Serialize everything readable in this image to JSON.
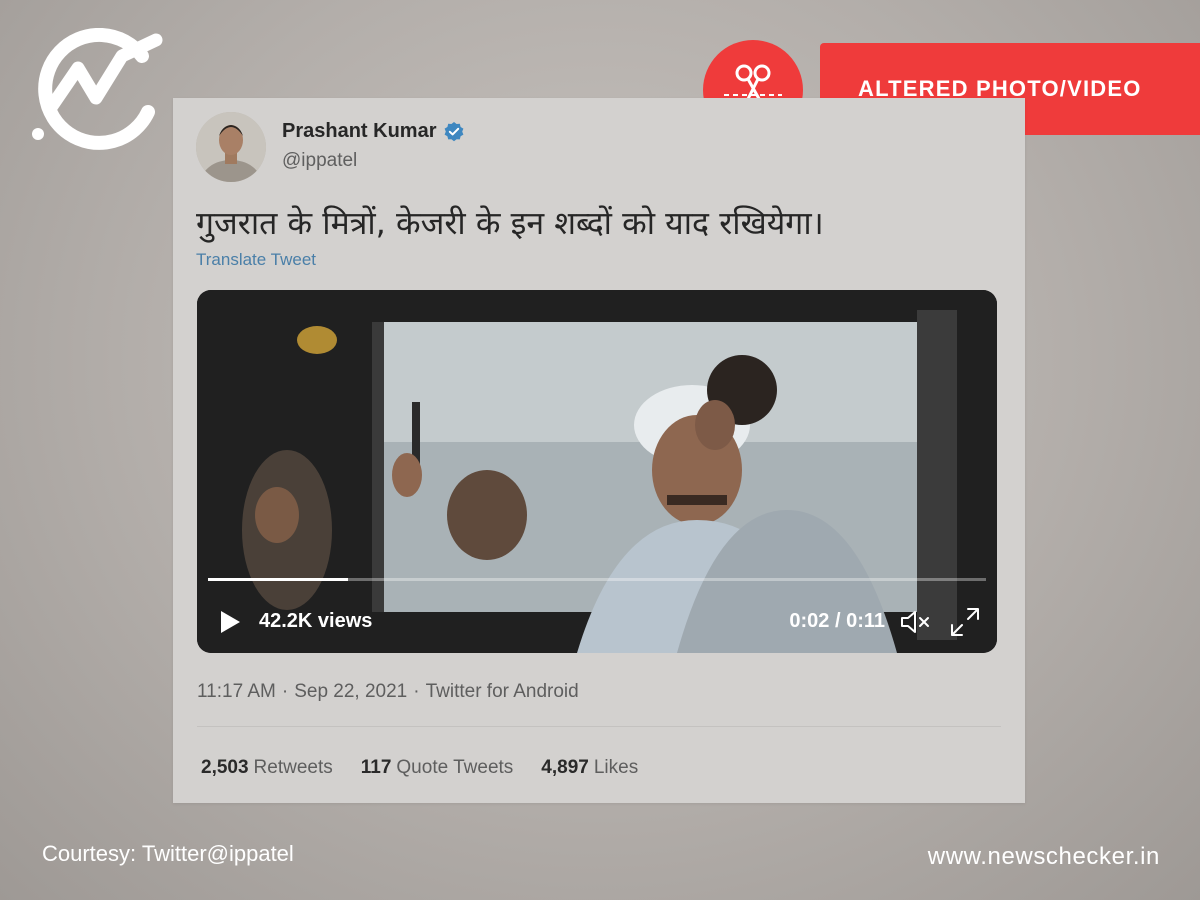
{
  "brand": {
    "logo_icon": "newschecker-check-icon",
    "site_url": "www.newschecker.in"
  },
  "badge": {
    "icon": "scissors-icon",
    "label": "ALTERED PHOTO/VIDEO",
    "color": "#ef3b3b"
  },
  "tweet": {
    "author_name": "Prashant Kumar",
    "verified_icon": "verified-badge-icon",
    "handle": "@ippatel",
    "text": "गुजरात के मित्रों, केजरी के इन शब्दों को याद रखियेगा।",
    "translate_label": "Translate Tweet",
    "video": {
      "views": "42.2K views",
      "time": "0:02 / 0:11",
      "progress_fraction": 0.18,
      "icons": [
        "play-icon",
        "mute-icon",
        "fullscreen-icon"
      ]
    },
    "time": "11:17 AM",
    "date": "Sep 22, 2021",
    "source": "Twitter for Android",
    "stats": {
      "retweets_count": "2,503",
      "retweets_label": "Retweets",
      "quotes_count": "117",
      "quotes_label": "Quote Tweets",
      "likes_count": "4,897",
      "likes_label": "Likes"
    }
  },
  "footer": {
    "courtesy": "Courtesy: Twitter@ippatel"
  },
  "colors": {
    "accent_red": "#ef3b3b",
    "link_blue": "#4a7fa8",
    "verified_blue": "#1d9bf0"
  }
}
